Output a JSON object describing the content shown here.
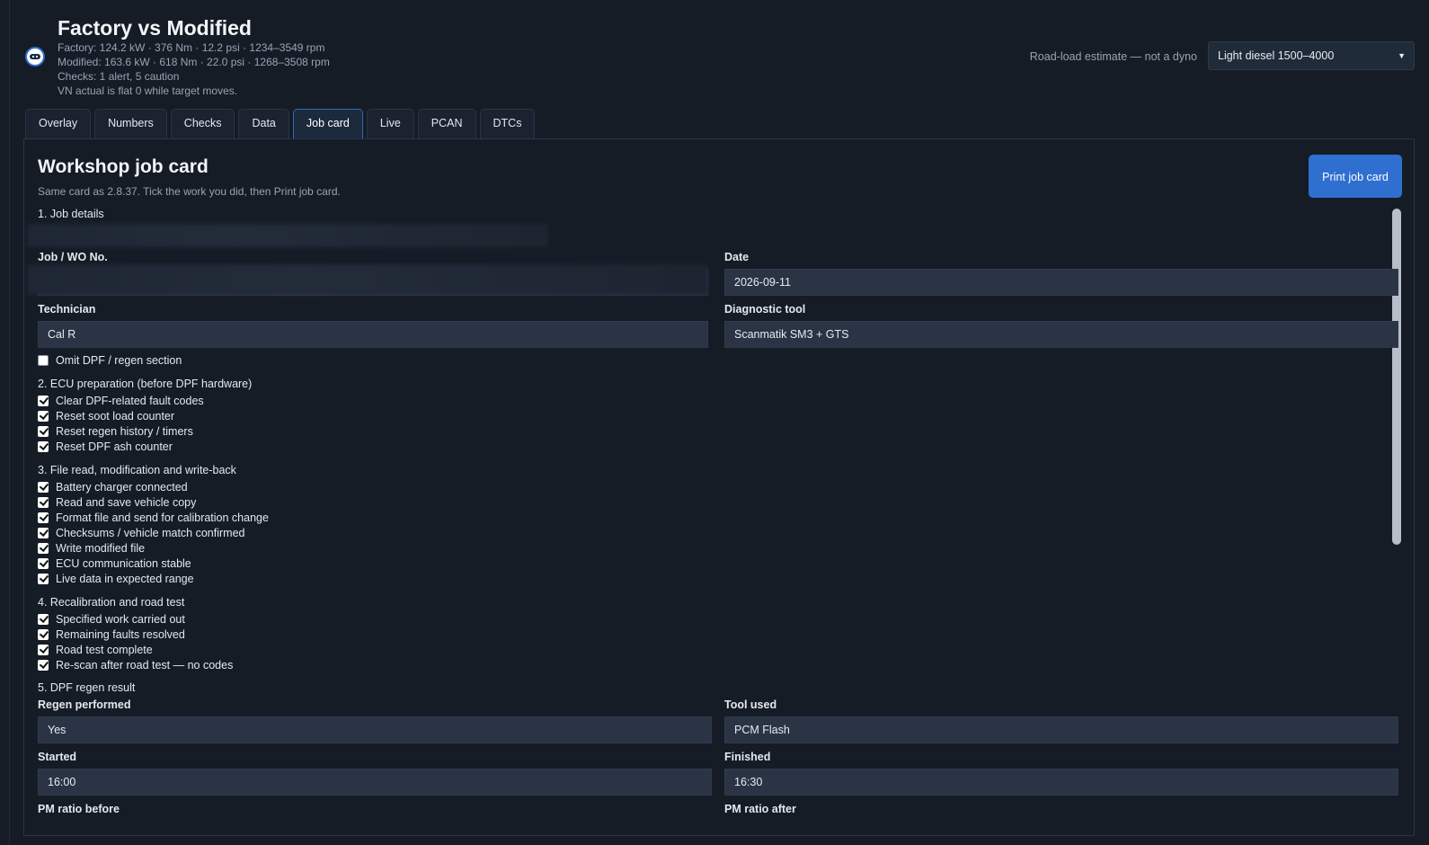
{
  "header": {
    "title": "Factory vs Modified",
    "factory_line": "Factory: 124.2 kW  ·  376 Nm  ·  12.2 psi  ·  1234–3549 rpm",
    "modified_line": "Modified: 163.6 kW  ·  618 Nm  ·  22.0 psi  ·  1268–3508 rpm",
    "checks_line": "Checks: 1 alert, 5 caution",
    "vn_line": "VN actual is flat 0 while target moves.",
    "road_note": "Road-load estimate — not a dyno",
    "profile_value": "Light diesel 1500–4000"
  },
  "tabs": [
    {
      "label": "Overlay"
    },
    {
      "label": "Numbers"
    },
    {
      "label": "Checks"
    },
    {
      "label": "Data"
    },
    {
      "label": "Job card",
      "active": true
    },
    {
      "label": "Live"
    },
    {
      "label": "PCAN"
    },
    {
      "label": "DTCs"
    }
  ],
  "card": {
    "title": "Workshop job card",
    "subtitle": "Same card as 2.8.37. Tick the work you did, then Print job card.",
    "print_label": "Print job card",
    "s1_title": "1. Job details",
    "job_label": "Job / WO No.",
    "job_value": "",
    "date_label": "Date",
    "date_value": "2026-09-11",
    "tech_label": "Technician",
    "tech_value": "Cal R",
    "tool_label": "Diagnostic tool",
    "tool_value": "Scanmatik SM3 + GTS",
    "omit_label": "Omit DPF / regen section",
    "s2_title": "2. ECU preparation (before DPF hardware)",
    "s2_items": [
      "Clear DPF-related fault codes",
      "Reset soot load counter",
      "Reset regen history / timers",
      "Reset DPF ash counter"
    ],
    "s3_title": "3. File read, modification and write-back",
    "s3_items": [
      "Battery charger connected",
      "Read and save vehicle copy",
      "Format file and send for calibration change",
      "Checksums / vehicle match confirmed",
      "Write modified file",
      "ECU communication stable",
      "Live data in expected range"
    ],
    "s4_title": "4. Recalibration and road test",
    "s4_items": [
      "Specified work carried out",
      "Remaining faults resolved",
      "Road test complete",
      "Re-scan after road test — no codes"
    ],
    "s5_title": "5. DPF regen result",
    "regen_label": "Regen performed",
    "regen_value": "Yes",
    "toolused_label": "Tool used",
    "toolused_value": "PCM Flash",
    "started_label": "Started",
    "started_value": "16:00",
    "finished_label": "Finished",
    "finished_value": "16:30",
    "pm_before_label": "PM ratio before",
    "pm_after_label": "PM ratio after"
  },
  "colors": {
    "accent": "#2f6fd0",
    "background": "#151c26",
    "field": "#2a3444"
  }
}
